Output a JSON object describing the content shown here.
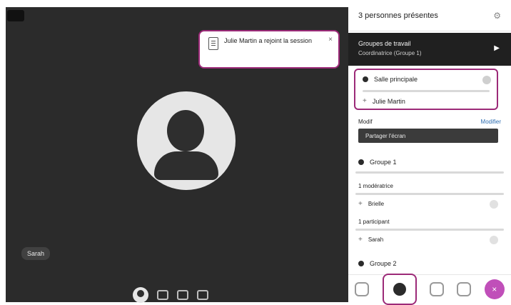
{
  "stage": {
    "participant_name": "Sarah"
  },
  "toast": {
    "message": "Julie Martin a rejoint la session",
    "close_glyph": "×"
  },
  "panel": {
    "header_title": "3 personnes présentes",
    "settings_glyph": "⚙",
    "work_group_title": "Groupes de travail",
    "work_group_subtitle": "Coordinatrice (Groupe 1)",
    "work_group_icon": "▶",
    "main_room_title": "Salle principale",
    "main_room_member": "Julie Martin",
    "modif_left": "Modif",
    "modif_right": "Modifier",
    "dark_button_label": "Partager l'écran",
    "group1_title": "Groupe 1",
    "group1_moderators_label": "1 modératrice",
    "group1_moderator_name": "Brielle",
    "group1_participants_label": "1 participant",
    "group1_participant_name": "Sarah",
    "group2_title": "Groupe 2"
  },
  "colors": {
    "accent": "#9c2a78",
    "fab": "#c04fb9",
    "stage_bg": "#2b2b2b"
  }
}
